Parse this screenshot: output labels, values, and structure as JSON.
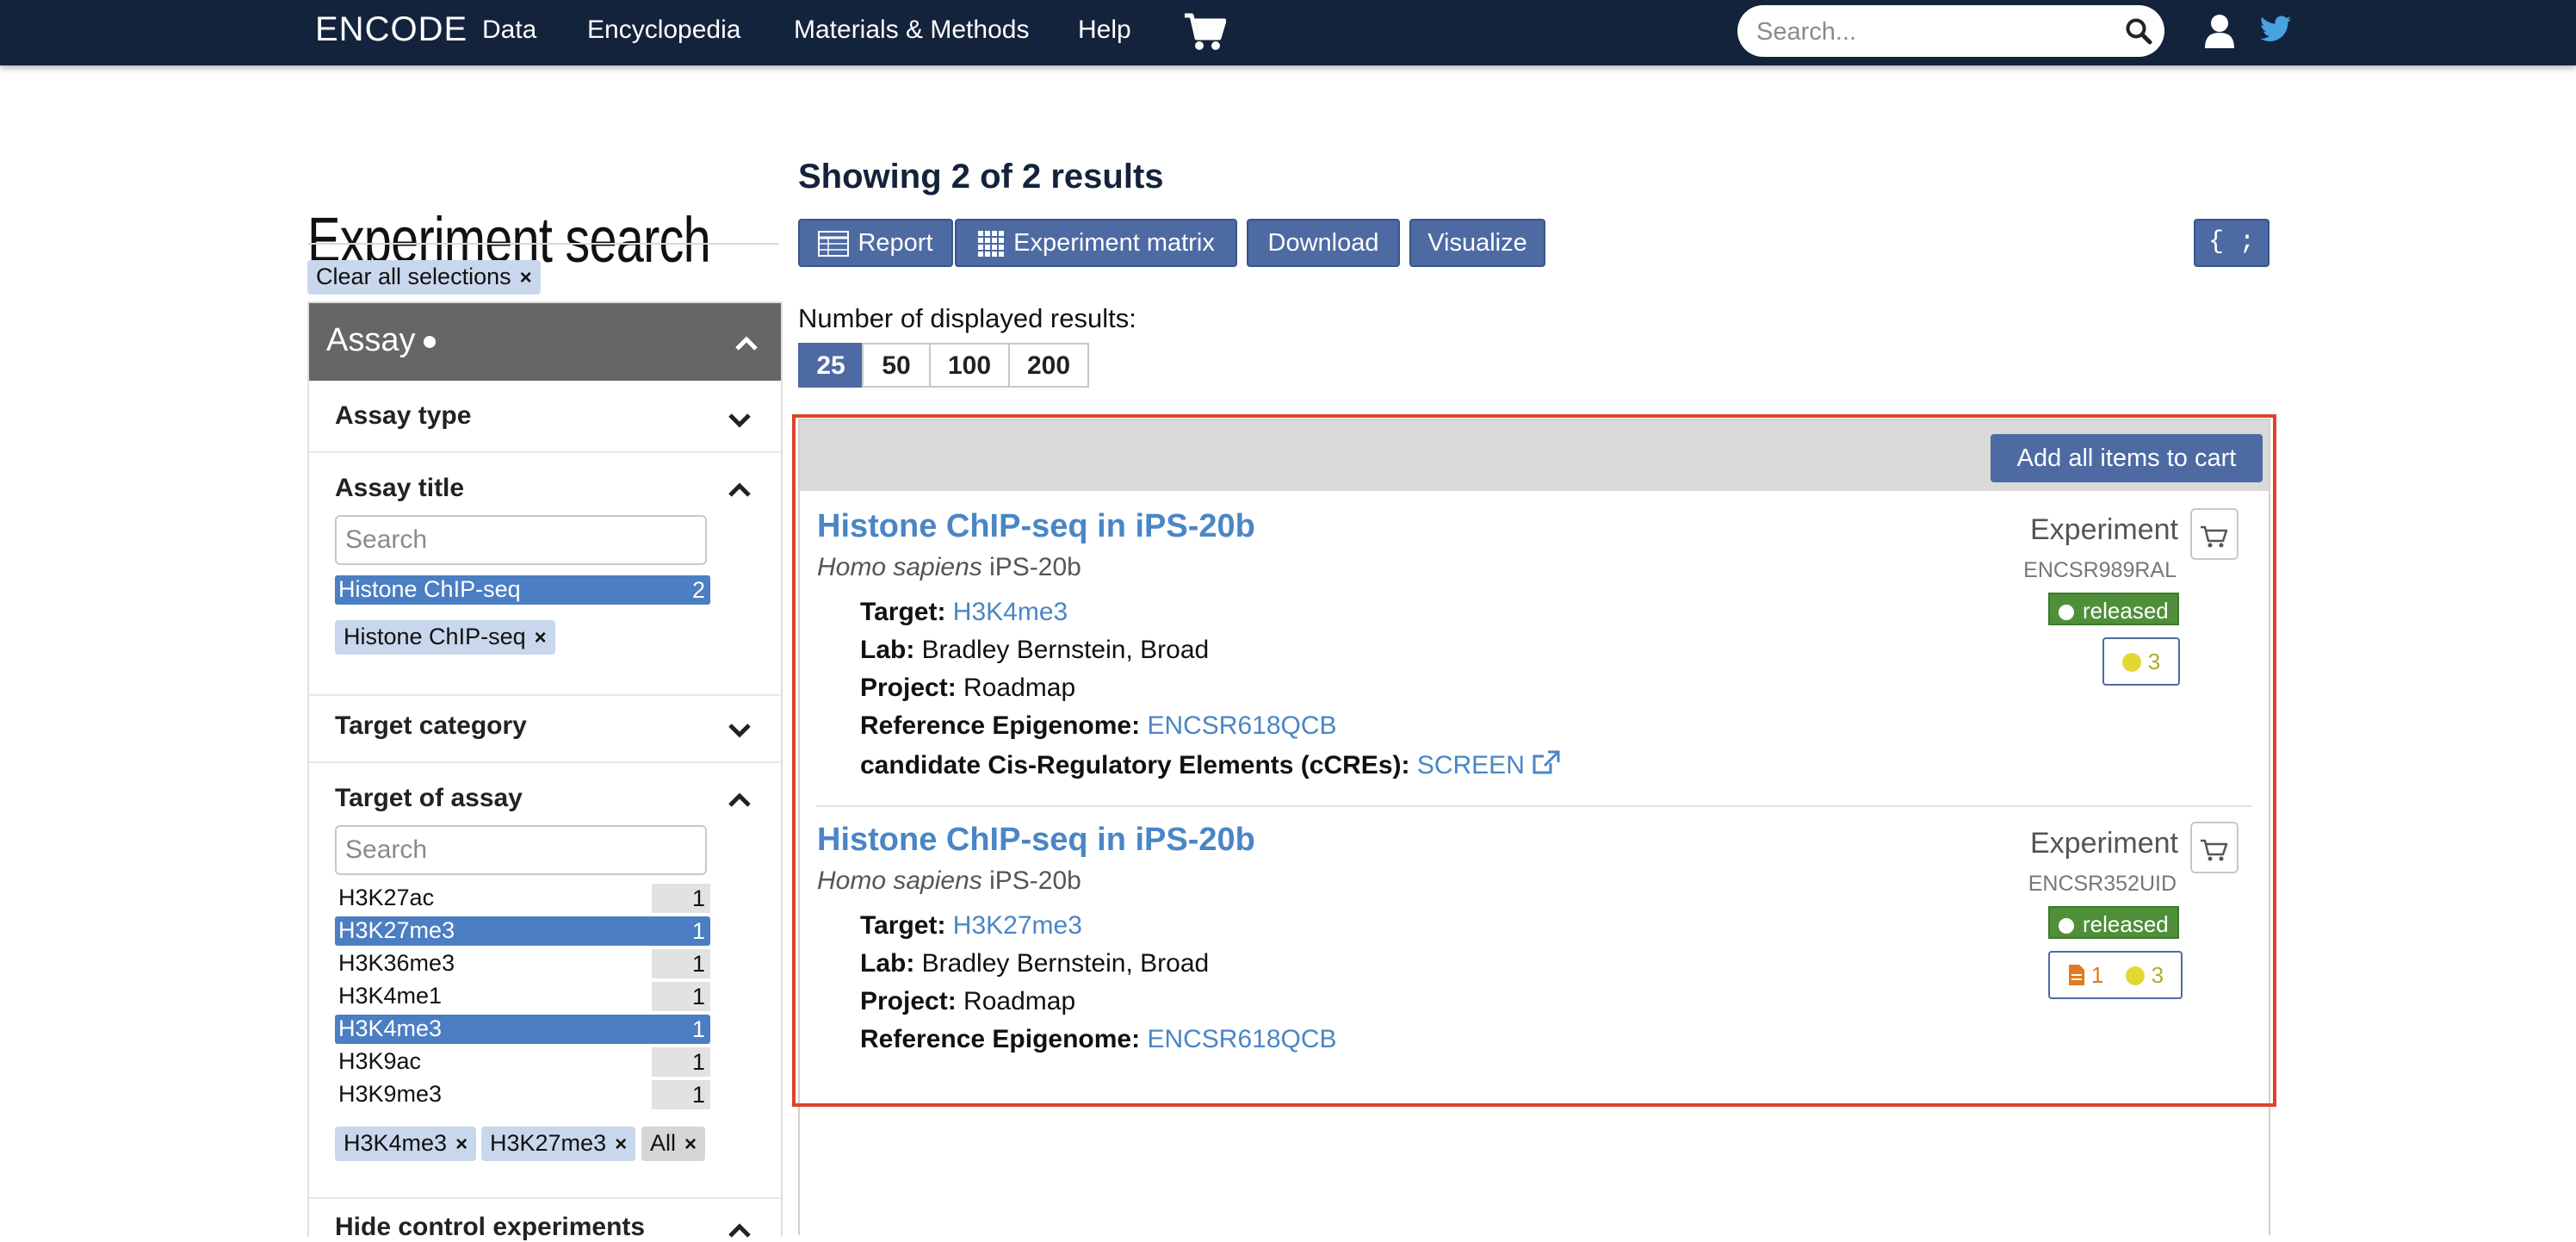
{
  "nav": {
    "brand": "ENCODE",
    "links": [
      "Data",
      "Encyclopedia",
      "Materials & Methods",
      "Help"
    ],
    "search_placeholder": "Search..."
  },
  "sidebar": {
    "page_title": "Experiment search",
    "clear_all": "Clear all selections",
    "assay_header": "Assay",
    "assay_type": "Assay type",
    "assay_title": "Assay title",
    "assay_title_search_placeholder": "Search",
    "assay_title_terms": [
      {
        "name": "Histone ChIP-seq",
        "count": "2"
      }
    ],
    "assay_title_pill": "Histone ChIP-seq",
    "target_category": "Target category",
    "target_of_assay": "Target of assay",
    "target_search_placeholder": "Search",
    "target_terms": [
      {
        "name": "H3K27ac",
        "count": "1",
        "selected": false
      },
      {
        "name": "H3K27me3",
        "count": "1",
        "selected": true
      },
      {
        "name": "H3K36me3",
        "count": "1",
        "selected": false
      },
      {
        "name": "H3K4me1",
        "count": "1",
        "selected": false
      },
      {
        "name": "H3K4me3",
        "count": "1",
        "selected": true
      },
      {
        "name": "H3K9ac",
        "count": "1",
        "selected": false
      },
      {
        "name": "H3K9me3",
        "count": "1",
        "selected": false
      }
    ],
    "target_pills": [
      "H3K4me3",
      "H3K27me3",
      "All"
    ],
    "hide_control": "Hide control experiments"
  },
  "main": {
    "results_count": "Showing 2 of 2 results",
    "buttons": {
      "report": "Report",
      "matrix": "Experiment matrix",
      "download": "Download",
      "visualize": "Visualize",
      "json": "{ ; }"
    },
    "num_label": "Number of displayed results:",
    "page_sizes": [
      "25",
      "50",
      "100",
      "200"
    ],
    "add_all_cart": "Add all items to cart",
    "results": [
      {
        "title": "Histone ChIP-seq in iPS-20b",
        "organism": "Homo sapiens",
        "biosample": "iPS-20b",
        "target_label": "Target:",
        "target": "H3K4me3",
        "lab_label": "Lab:",
        "lab": "Bradley Bernstein, Broad",
        "project_label": "Project:",
        "project": "Roadmap",
        "ref_label": "Reference Epigenome:",
        "ref": "ENCSR618QCB",
        "ccre_label": "candidate Cis-Regulatory Elements (cCREs):",
        "ccre": "SCREEN",
        "type": "Experiment",
        "accession": "ENCSR989RAL",
        "status": "released",
        "audit_yellow": "3"
      },
      {
        "title": "Histone ChIP-seq in iPS-20b",
        "organism": "Homo sapiens",
        "biosample": "iPS-20b",
        "target_label": "Target:",
        "target": "H3K27me3",
        "lab_label": "Lab:",
        "lab": "Bradley Bernstein, Broad",
        "project_label": "Project:",
        "project": "Roadmap",
        "ref_label": "Reference Epigenome:",
        "ref": "ENCSR618QCB",
        "type": "Experiment",
        "accession": "ENCSR352UID",
        "status": "released",
        "audit_orange": "1",
        "audit_yellow": "3"
      }
    ]
  },
  "colors": {
    "navbar": "#14233c",
    "button": "#4d6aa3",
    "link": "#4a86c5",
    "selected_term": "#4b7ec3",
    "status_released": "#4f8f3a",
    "highlight": "#e0432b"
  }
}
